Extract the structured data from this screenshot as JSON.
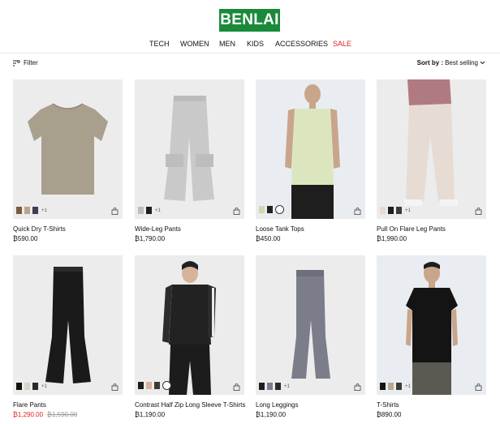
{
  "brand": {
    "logo_text": "BENLAI",
    "color": "#1a8a3a"
  },
  "nav": [
    "TECH",
    "WOMEN",
    "MEN",
    "KIDS",
    "ACCESSORIES",
    "SALE"
  ],
  "toolbar": {
    "filter_label": "Filter",
    "sort_label": "Sort by :",
    "sort_value": "Best selling"
  },
  "products": [
    {
      "title": "Quick Dry T-Shirts",
      "price": "₿590.00",
      "original_price": "",
      "more_colors": "+1"
    },
    {
      "title": "Wide-Leg Pants",
      "price": "₿1,790.00",
      "original_price": "",
      "more_colors": "+1"
    },
    {
      "title": "Loose Tank Tops",
      "price": "₿450.00",
      "original_price": "",
      "more_colors": ""
    },
    {
      "title": "Pull On Flare Leg Pants",
      "price": "₿1,990.00",
      "original_price": "",
      "more_colors": "+1"
    },
    {
      "title": "Flare Pants",
      "price": "₿1,290.00",
      "original_price": "₿1,590.00",
      "more_colors": "+1"
    },
    {
      "title": "Contrast Half Zip Long Sleeve T-Shirts",
      "price": "₿1,190.00",
      "original_price": "",
      "more_colors": ""
    },
    {
      "title": "Long Leggings",
      "price": "₿1,190.00",
      "original_price": "",
      "more_colors": "+1"
    },
    {
      "title": "T-Shirts",
      "price": "₿890.00",
      "original_price": "",
      "more_colors": "+1"
    }
  ],
  "colors": {
    "sale": "#e02020",
    "image_bg": "#ececec"
  }
}
